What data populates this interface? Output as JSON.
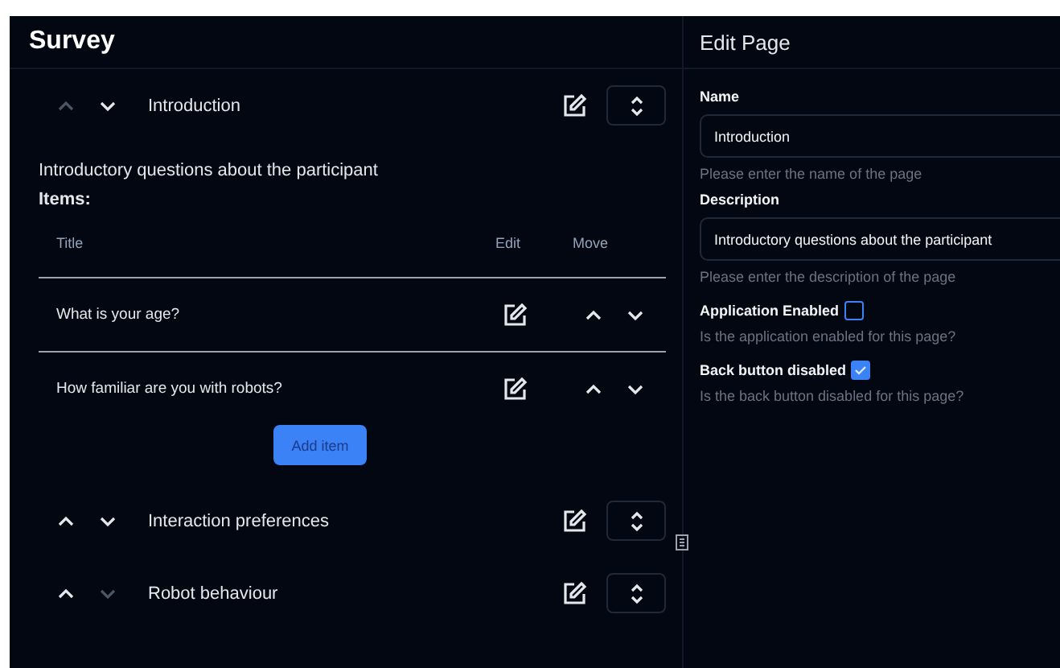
{
  "survey": {
    "title": "Survey",
    "pages": [
      {
        "name": "Introduction",
        "up_disabled": true,
        "down_disabled": false,
        "description": "Introductory questions about the participant",
        "items_label": "Items:",
        "columns": [
          "Title",
          "Edit",
          "Move"
        ],
        "items": [
          {
            "title": "What is your age?",
            "up_disabled": false,
            "down_disabled": false
          },
          {
            "title": "How familiar are you with robots?",
            "up_disabled": false,
            "down_disabled": false
          }
        ],
        "add_button": "Add item"
      },
      {
        "name": "Interaction preferences",
        "up_disabled": false,
        "down_disabled": false
      },
      {
        "name": "Robot behaviour",
        "up_disabled": false,
        "down_disabled": true
      }
    ]
  },
  "editor": {
    "title": "Edit Page",
    "fields": [
      {
        "label": "Name",
        "value": "Introduction",
        "help": "Please enter the name of the page"
      },
      {
        "label": "Description",
        "value": "Introductory questions about the participant",
        "help": "Please enter the description of the page"
      }
    ],
    "checkboxes": [
      {
        "label": "Application Enabled",
        "checked": false,
        "help": "Is the application enabled for this page?"
      },
      {
        "label": "Back button disabled",
        "checked": true,
        "help": "Is the back button disabled for this page?"
      }
    ]
  }
}
